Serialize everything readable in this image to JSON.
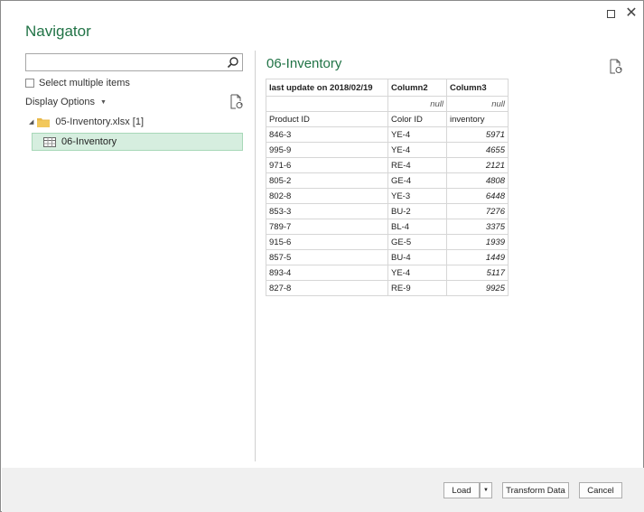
{
  "window": {
    "title": "Navigator",
    "maximize_icon": "maximize-icon",
    "close_glyph": "✕"
  },
  "left_pane": {
    "search": {
      "value": "",
      "placeholder": ""
    },
    "select_multiple_label": "Select multiple items",
    "select_multiple_checked": false,
    "display_options_label": "Display Options",
    "tree": {
      "folder_label": "05-Inventory.xlsx [1]",
      "items": [
        {
          "label": "06-Inventory",
          "selected": true
        }
      ]
    }
  },
  "preview": {
    "title": "06-Inventory",
    "columns": [
      "last update on 2018/02/19",
      "Column2",
      "Column3"
    ],
    "rows": [
      [
        "",
        "null",
        "null"
      ],
      [
        "Product ID",
        "Color ID",
        "inventory"
      ],
      [
        "846-3",
        "YE-4",
        "5971"
      ],
      [
        "995-9",
        "YE-4",
        "4655"
      ],
      [
        "971-6",
        "RE-4",
        "2121"
      ],
      [
        "805-2",
        "GE-4",
        "4808"
      ],
      [
        "802-8",
        "YE-3",
        "6448"
      ],
      [
        "853-3",
        "BU-2",
        "7276"
      ],
      [
        "789-7",
        "BL-4",
        "3375"
      ],
      [
        "915-6",
        "GE-5",
        "1939"
      ],
      [
        "857-5",
        "BU-4",
        "1449"
      ],
      [
        "893-4",
        "YE-4",
        "5117"
      ],
      [
        "827-8",
        "RE-9",
        "9925"
      ]
    ]
  },
  "footer": {
    "load_label": "Load",
    "transform_label": "Transform Data",
    "cancel_label": "Cancel"
  },
  "colors": {
    "accent": "#217346",
    "selected_bg": "#d6eedf"
  }
}
